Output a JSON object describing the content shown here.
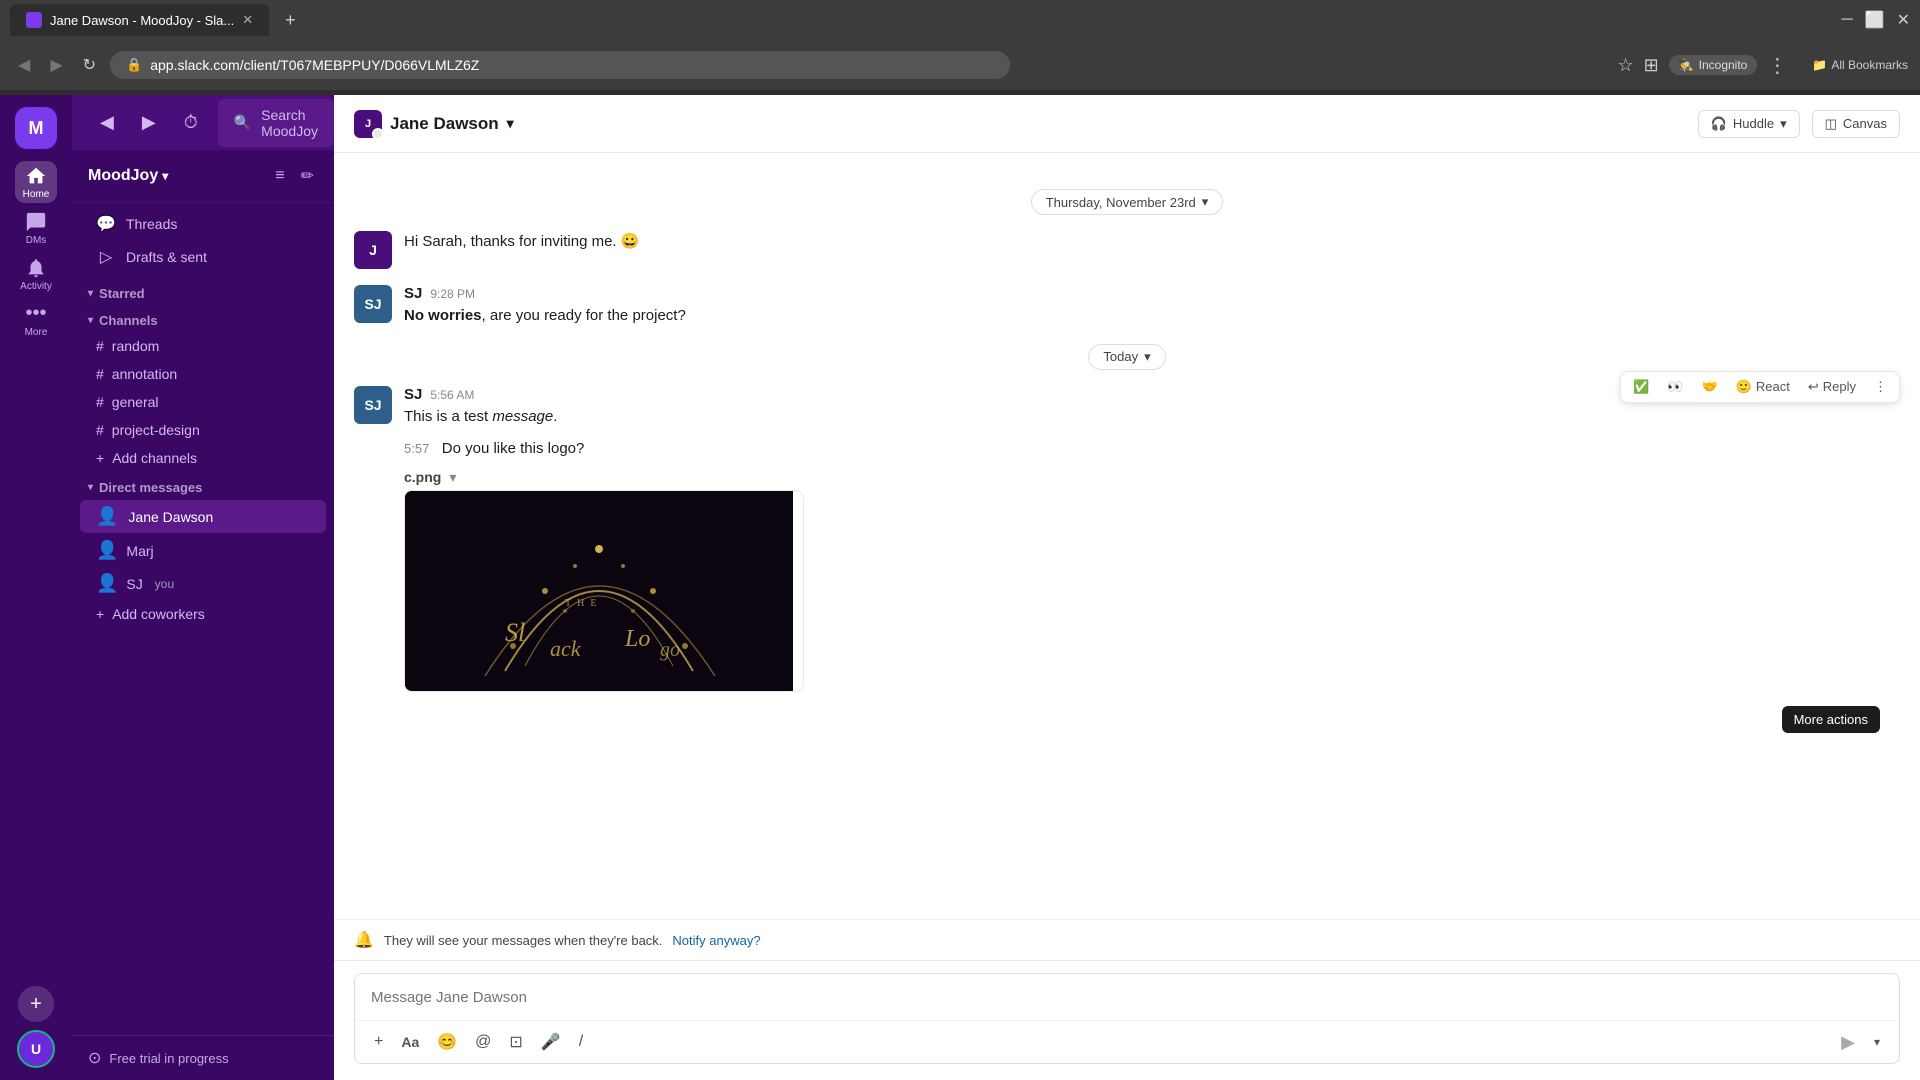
{
  "browser": {
    "tab_title": "Jane Dawson - MoodJoy - Sla...",
    "url": "app.slack.com/client/T067MEBPPUY/D066VLMLZ6Z",
    "incognito_label": "Incognito",
    "bookmarks_label": "All Bookmarks"
  },
  "app": {
    "workspace_name": "MoodJoy",
    "search_placeholder": "Search MoodJoy",
    "help_icon": "?"
  },
  "sidebar": {
    "threads_label": "Threads",
    "drafts_sent_label": "Drafts & sent",
    "starred_label": "Starred",
    "starred_section": "Starred",
    "channels_section": "Channels",
    "channels": [
      {
        "name": "random"
      },
      {
        "name": "annotation"
      },
      {
        "name": "general"
      },
      {
        "name": "project-design"
      }
    ],
    "add_channels_label": "Add channels",
    "dm_section": "Direct messages",
    "dm_users": [
      {
        "name": "Jane Dawson",
        "active": true
      },
      {
        "name": "Marj"
      },
      {
        "name": "SJ",
        "suffix": "you"
      }
    ],
    "add_coworkers_label": "Add coworkers",
    "trial_label": "Free trial in progress"
  },
  "main": {
    "dm_user": "Jane Dawson",
    "huddle_label": "Huddle",
    "canvas_label": "Canvas",
    "date_thursday": "Thursday, November 23rd",
    "date_today": "Today",
    "messages": [
      {
        "author": "Jane",
        "avatar_text": "J",
        "time": "",
        "text": "Hi Sarah, thanks for inviting me. 😀"
      },
      {
        "author": "SJ",
        "avatar_text": "SJ",
        "time": "9:28 PM",
        "text_bold": "No worries",
        "text_rest": ", are you ready for the project?"
      }
    ],
    "today_message": {
      "author": "SJ",
      "avatar_text": "SJ",
      "time": "5:56 AM",
      "text1": "This is a test ",
      "text1_italic": "message",
      "time2": "5:57",
      "text2": "Do you like this logo?",
      "attachment_name": "c.png"
    },
    "notification": {
      "text": "They will see your messages when they're back.",
      "link": "Notify anyway?"
    },
    "input_placeholder": "Message Jane Dawson",
    "more_actions_label": "More actions",
    "reply_label": "Reply",
    "react_label": "React"
  },
  "icons": {
    "checkmark": "✓",
    "eyes": "👀",
    "hands": "🤝",
    "more": "⋯",
    "emoji": "😀",
    "at": "@",
    "format": "Aa",
    "video": "⊡",
    "mic": "🎤",
    "slash": "/"
  }
}
